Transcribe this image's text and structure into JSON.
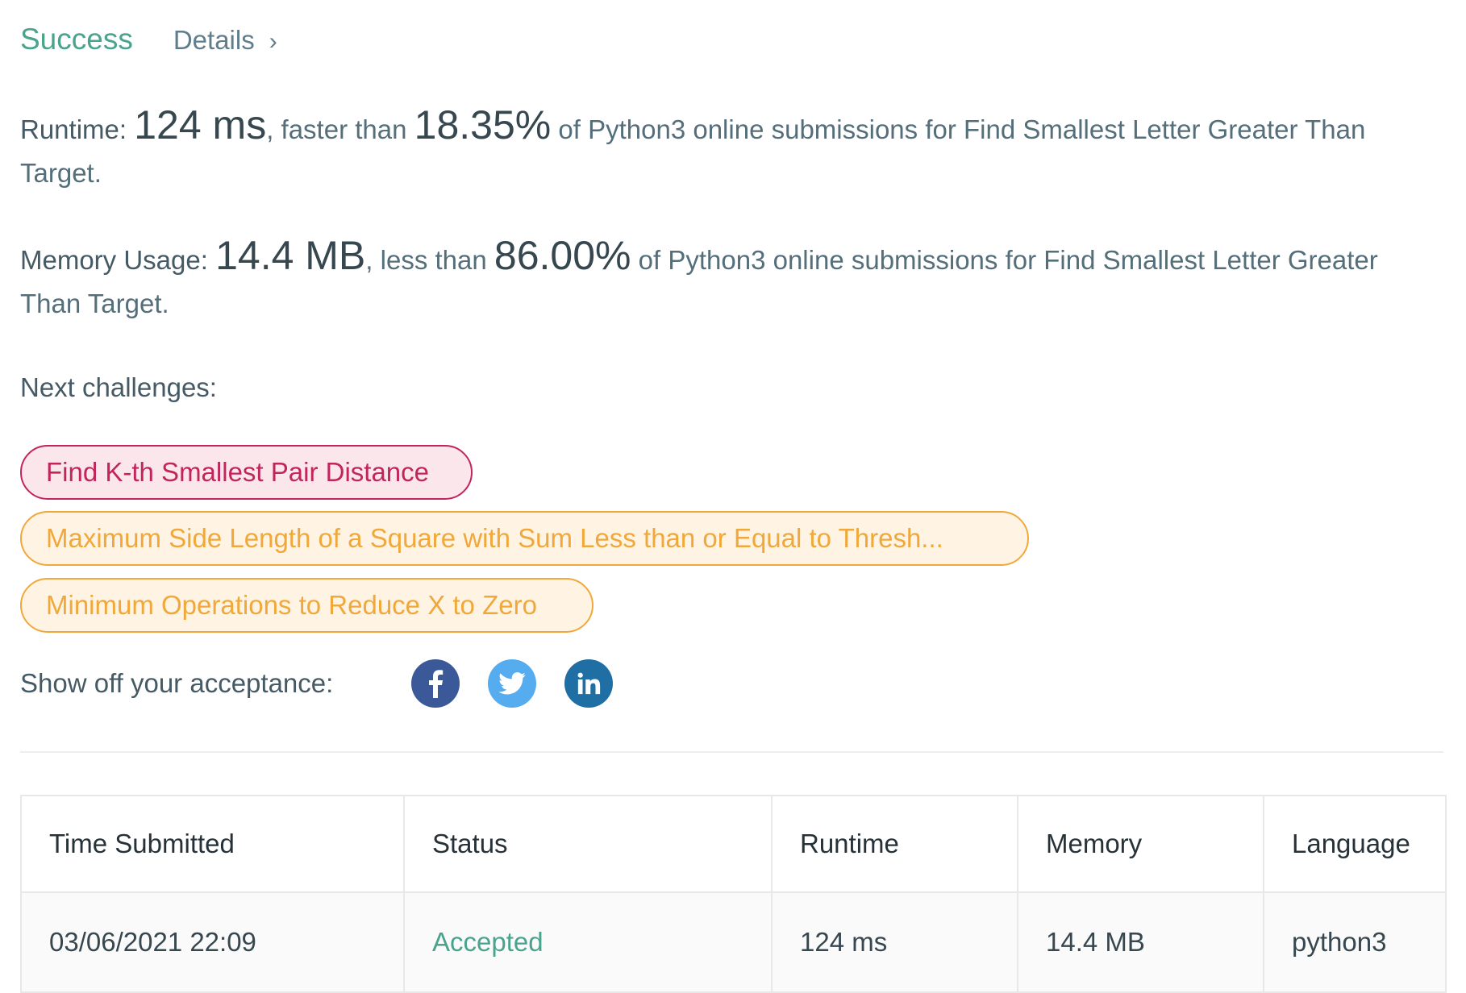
{
  "header": {
    "status": "Success",
    "details_label": "Details",
    "details_chevron": "›"
  },
  "runtime": {
    "label": "Runtime:",
    "value": "124 ms",
    "comparison": ", faster than",
    "percent": "18.35%",
    "suffix": "of Python3 online submissions for Find Smallest Letter Greater Than Target."
  },
  "memory": {
    "label": "Memory Usage:",
    "value": "14.4 MB",
    "comparison": ", less than",
    "percent": "86.00%",
    "suffix": "of Python3 online submissions for Find Smallest Letter Greater Than Target."
  },
  "next_challenges": {
    "label": "Next challenges:",
    "items": [
      {
        "title": "Find K-th Smallest Pair Distance",
        "difficulty": "hard",
        "color": "#c2255c"
      },
      {
        "title": "Maximum Side Length of a Square with Sum Less than or Equal to Thresh...",
        "difficulty": "medium",
        "color": "#f0a83a"
      },
      {
        "title": "Minimum Operations to Reduce X to Zero",
        "difficulty": "medium",
        "color": "#f0a83a"
      }
    ]
  },
  "share": {
    "label": "Show off your acceptance:",
    "icons": [
      "facebook-icon",
      "twitter-icon",
      "linkedin-icon"
    ]
  },
  "submissions": {
    "headers": [
      "Time Submitted",
      "Status",
      "Runtime",
      "Memory",
      "Language"
    ],
    "rows": [
      {
        "time": "03/06/2021 22:09",
        "status": "Accepted",
        "runtime": "124 ms",
        "memory": "14.4 MB",
        "language": "python3"
      }
    ]
  },
  "colors": {
    "success": "#4aa38c",
    "hard": "#c2255c",
    "medium": "#f0a83a",
    "facebook": "#3b5998",
    "twitter": "#55acee",
    "linkedin": "#1f6fa4"
  }
}
